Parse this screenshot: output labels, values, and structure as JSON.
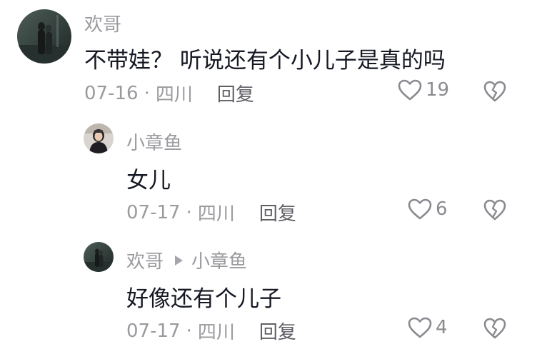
{
  "comments": [
    {
      "author": "欢哥",
      "text": "不带娃？ 听说还有个小儿子是真的吗",
      "date": "07-16",
      "location": "四川",
      "reply_label": "回复",
      "likes": "19",
      "avatar_icon": "couple-photo-avatar"
    },
    {
      "author": "小章鱼",
      "text": "女儿",
      "date": "07-17",
      "location": "四川",
      "reply_label": "回复",
      "likes": "6",
      "avatar_icon": "girl-photo-avatar"
    },
    {
      "author": "欢哥",
      "reply_to": "小章鱼",
      "text": "好像还有个儿子",
      "date": "07-17",
      "location": "四川",
      "reply_label": "回复",
      "likes": "4",
      "avatar_icon": "couple-photo-avatar"
    }
  ],
  "separator": "·",
  "colors": {
    "primary_text": "#161823",
    "secondary_text": "#9a9a9f",
    "icon": "#8a8a90"
  }
}
